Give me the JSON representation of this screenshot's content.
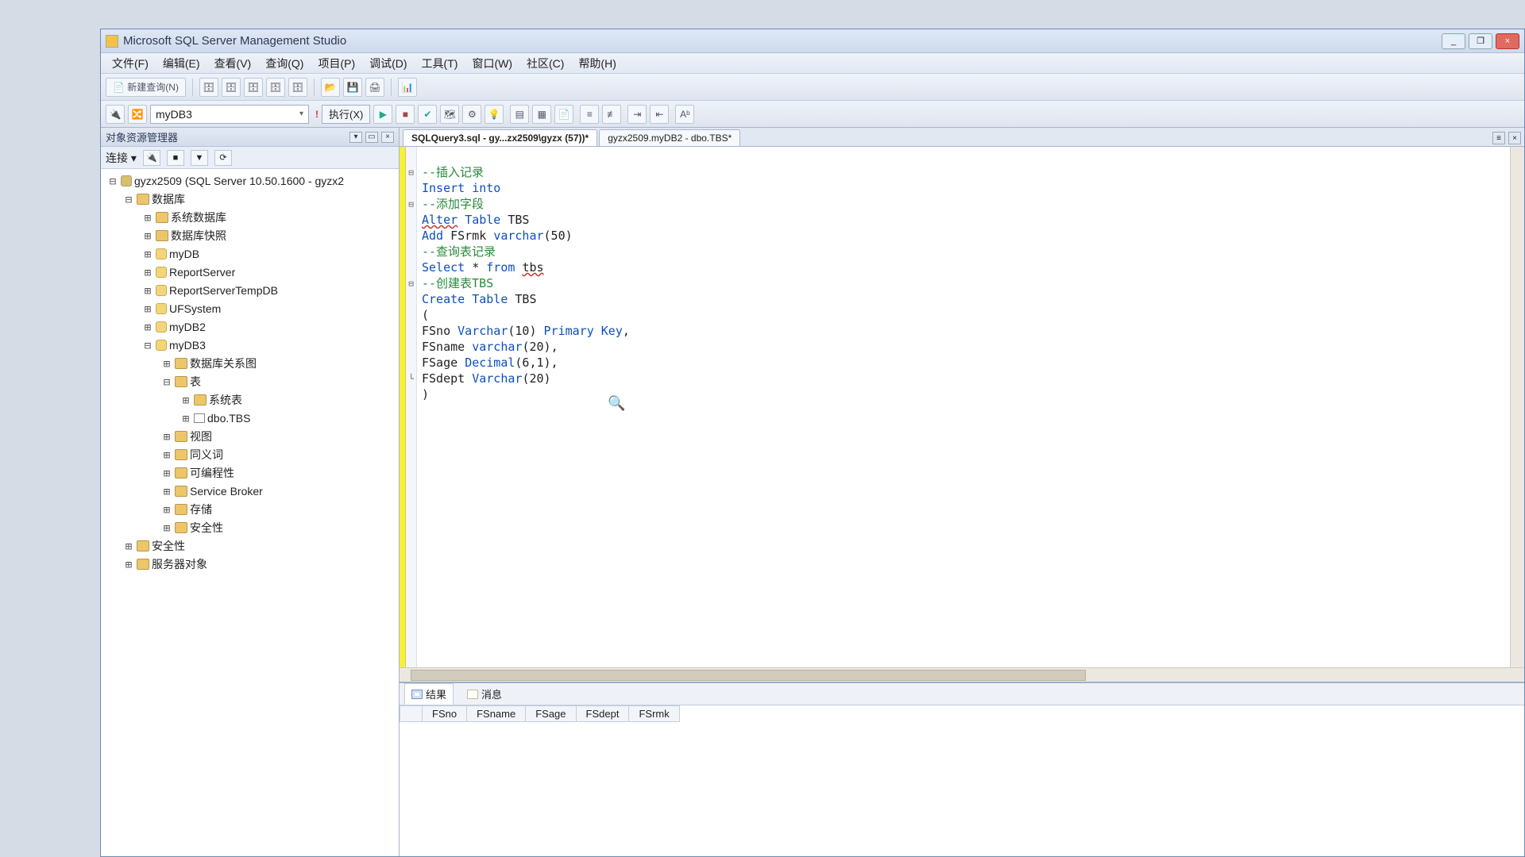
{
  "app": {
    "title": "Microsoft SQL Server Management Studio"
  },
  "window_buttons": {
    "min": "_",
    "max": "❐",
    "close": "×"
  },
  "menus": [
    "文件(F)",
    "编辑(E)",
    "查看(V)",
    "查询(Q)",
    "项目(P)",
    "调试(D)",
    "工具(T)",
    "窗口(W)",
    "社区(C)",
    "帮助(H)"
  ],
  "toolbar1": {
    "new_query": "新建查询(N)"
  },
  "toolbar2": {
    "db_selected": "myDB3",
    "execute": "执行(X)"
  },
  "explorer": {
    "title": "对象资源管理器",
    "connect_label": "连接 ▾",
    "root": "gyzx2509 (SQL Server 10.50.1600 - gyzx2",
    "databases_label": "数据库",
    "sys_db": "系统数据库",
    "snapshot": "数据库快照",
    "dbs": [
      "myDB",
      "ReportServer",
      "ReportServerTempDB",
      "UFSystem",
      "myDB2",
      "myDB3"
    ],
    "mydb3": {
      "diagrams": "数据库关系图",
      "tables": "表",
      "sys_tables": "系统表",
      "user_table": "dbo.TBS",
      "views": "视图",
      "synonyms": "同义词",
      "programmability": "可编程性",
      "service_broker": "Service Broker",
      "storage": "存储",
      "security": "安全性"
    },
    "server_security": "安全性",
    "server_objects": "服务器对象"
  },
  "tabs": {
    "active": "SQLQuery3.sql - gy...zx2509\\gyzx (57))*",
    "inactive": "gyzx2509.myDB2 - dbo.TBS*"
  },
  "code": {
    "l1_cmt": "--插入记录",
    "l2a": "Insert",
    "l2b": "into",
    "l3_cmt": "--添加字段",
    "l4a": "Alter",
    "l4b": "Table",
    "l4c": "TBS",
    "l5a": "Add",
    "l5b": "FSrmk",
    "l5c": "varchar",
    "l5d": "(50)",
    "l6_cmt": "--查询表记录",
    "l7a": "Select",
    "l7b": "*",
    "l7c": "from",
    "l7d": "tbs",
    "l8_cmt": "--创建表TBS",
    "l9a": "Create",
    "l9b": "Table",
    "l9c": "TBS",
    "l10": "(",
    "l11a": "FSno",
    "l11b": "Varchar",
    "l11c": "(10)",
    "l11d": "Primary",
    "l11e": "Key",
    "l11f": ",",
    "l12a": "FSname",
    "l12b": "varchar",
    "l12c": "(20)",
    "l12d": ",",
    "l13a": "FSage",
    "l13b": "Decimal",
    "l13c": "(6,1)",
    "l13d": ",",
    "l14a": "FSdept",
    "l14b": "Varchar",
    "l14c": "(20)",
    "l15": ")"
  },
  "results": {
    "tab_results": "结果",
    "tab_messages": "消息",
    "columns": [
      "FSno",
      "FSname",
      "FSage",
      "FSdept",
      "FSrmk"
    ]
  }
}
